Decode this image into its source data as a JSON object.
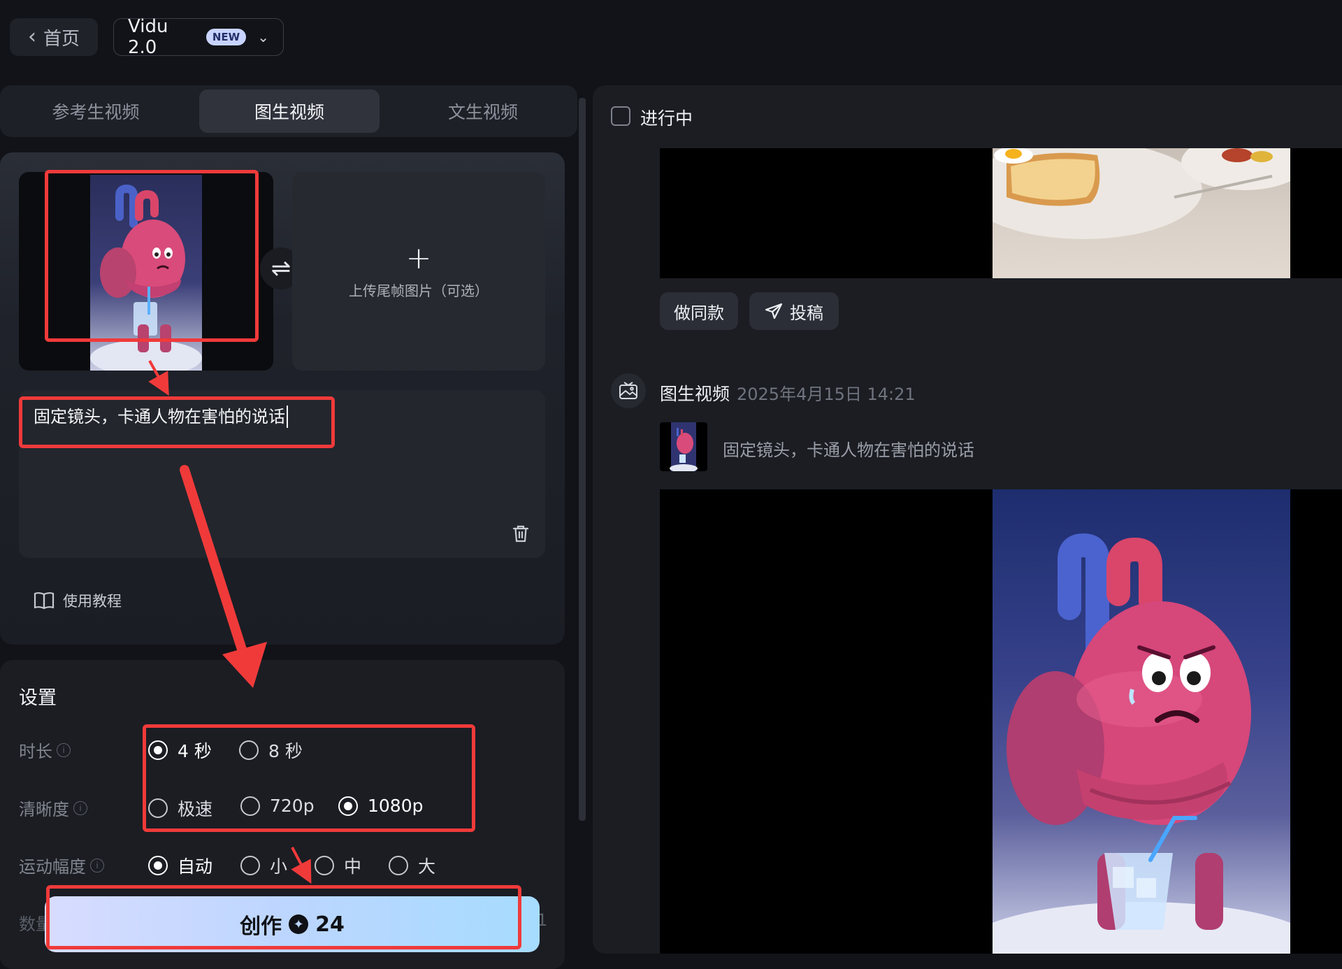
{
  "topbar": {
    "home_label": "首页",
    "model_name": "Vidu 2.0",
    "model_badge": "NEW"
  },
  "tabs": [
    {
      "label": "参考生视频",
      "active": false
    },
    {
      "label": "图生视频",
      "active": true
    },
    {
      "label": "文生视频",
      "active": false
    }
  ],
  "upload": {
    "last_frame_label": "上传尾帧图片（可选）"
  },
  "prompt": {
    "text": "固定镜头，卡通人物在害怕的说话"
  },
  "tutorial_label": "使用教程",
  "settings": {
    "title": "设置",
    "duration": {
      "label": "时长",
      "options": [
        "4 秒",
        "8 秒"
      ],
      "selected": "4 秒"
    },
    "resolution": {
      "label": "清晰度",
      "options": [
        "极速",
        "720p",
        "1080p"
      ],
      "selected": "1080p"
    },
    "motion": {
      "label": "运动幅度",
      "options": [
        "自动",
        "小",
        "中",
        "大"
      ],
      "selected": "自动"
    },
    "quantity": {
      "label": "数量",
      "value": "1"
    }
  },
  "create_button": {
    "label": "创作",
    "credits": "24"
  },
  "right": {
    "in_progress_label": "进行中",
    "actions": {
      "same_style": "做同款",
      "submit": "投稿"
    },
    "task": {
      "type": "图生视频",
      "timestamp": "2025年4月15日 14:21",
      "prompt": "固定镜头，卡通人物在害怕的说话"
    }
  },
  "colors": {
    "background": "#111318",
    "panel": "#1b1d23",
    "annotation_red": "#f03a3a",
    "create_gradient_start": "#d8dcff",
    "create_gradient_end": "#a6dcff"
  }
}
